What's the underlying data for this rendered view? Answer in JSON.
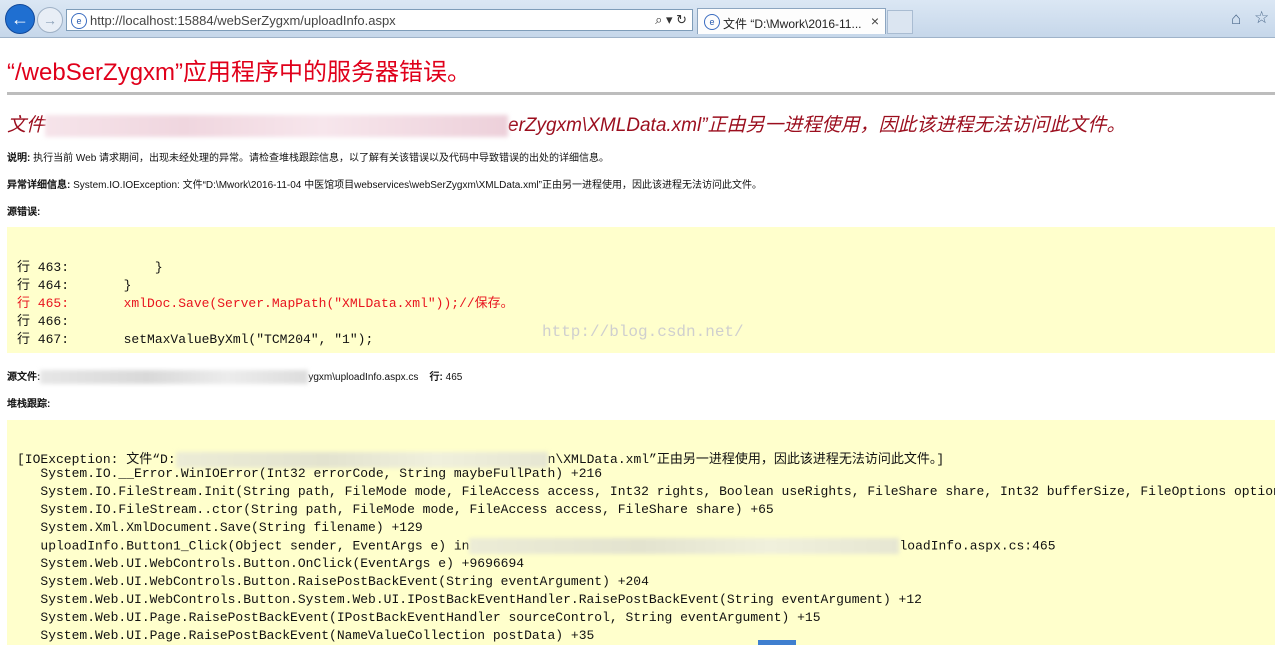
{
  "browser": {
    "url": "http://localhost:15884/webSerZygxm/uploadInfo.aspx",
    "url_tools": "⌕ ▾ ↻",
    "tab_title": "文件 “D:\\Mwork\\2016-11...",
    "tab_close": "×",
    "back_icon": "back-arrow-icon",
    "forward_icon": "forward-arrow-icon",
    "home_icon": "home-icon",
    "star_icon": "star-icon"
  },
  "page": {
    "title": "“/webSerZygxm”应用程序中的服务器错误。",
    "error_heading_start": "文件",
    "error_heading_end": "erZygxm\\XMLData.xml”正由另一进程使用，因此该进程无法访问此文件。",
    "description_label": "说明:",
    "description_text": " 执行当前 Web 请求期间，出现未经处理的异常。请检查堆栈跟踪信息，以了解有关该错误以及代码中导致错误的出处的详细信息。",
    "exception_label": "异常详细信息:",
    "exception_text": " System.IO.IOException: 文件“D:\\Mwork\\2016-11-04 中医馆项目webservices\\webSerZygxm\\XMLData.xml”正由另一进程使用，因此该进程无法访问此文件。",
    "source_error_label": "源错误:",
    "source_lines": [
      {
        "text": "行 463:           }",
        "error": false
      },
      {
        "text": "行 464:       }",
        "error": false
      },
      {
        "text": "行 465:       xmlDoc.Save(Server.MapPath(\"XMLData.xml\"));//保存。",
        "error": true
      },
      {
        "text": "行 466:",
        "error": false
      },
      {
        "text": "行 467:       setMaxValueByXml(\"TCM204\", \"1\");",
        "error": false
      }
    ],
    "watermark": "http://blog.csdn.net/",
    "source_file_label": "源文件:",
    "source_file_end": "ygxm\\uploadInfo.aspx.cs",
    "line_label": "行:",
    "line_value": " 465",
    "stack_label": "堆栈跟踪:",
    "stack_first_start": "[IOException: 文件“D:",
    "stack_first_end": "n\\XMLData.xml”正由另一进程使用，因此该进程无法访问此文件。]",
    "stack_lines": [
      "   System.IO.__Error.WinIOError(Int32 errorCode, String maybeFullPath) +216",
      "   System.IO.FileStream.Init(String path, FileMode mode, FileAccess access, Int32 rights, Boolean useRights, FileShare share, Int32 bufferSize, FileOptions options,",
      "   System.IO.FileStream..ctor(String path, FileMode mode, FileAccess access, FileShare share) +65",
      "   System.Xml.XmlDocument.Save(String filename) +129"
    ],
    "stack_click_start": "   uploadInfo.Button1_Click(Object sender, EventArgs e) in",
    "stack_click_end": "loadInfo.aspx.cs:465",
    "stack_lines_after": [
      "   System.Web.UI.WebControls.Button.OnClick(EventArgs e) +9696694",
      "   System.Web.UI.WebControls.Button.RaisePostBackEvent(String eventArgument) +204",
      "   System.Web.UI.WebControls.Button.System.Web.UI.IPostBackEventHandler.RaisePostBackEvent(String eventArgument) +12",
      "   System.Web.UI.Page.RaisePostBackEvent(IPostBackEventHandler sourceControl, String eventArgument) +15",
      "   System.Web.UI.Page.RaisePostBackEvent(NameValueCollection postData) +35"
    ]
  }
}
